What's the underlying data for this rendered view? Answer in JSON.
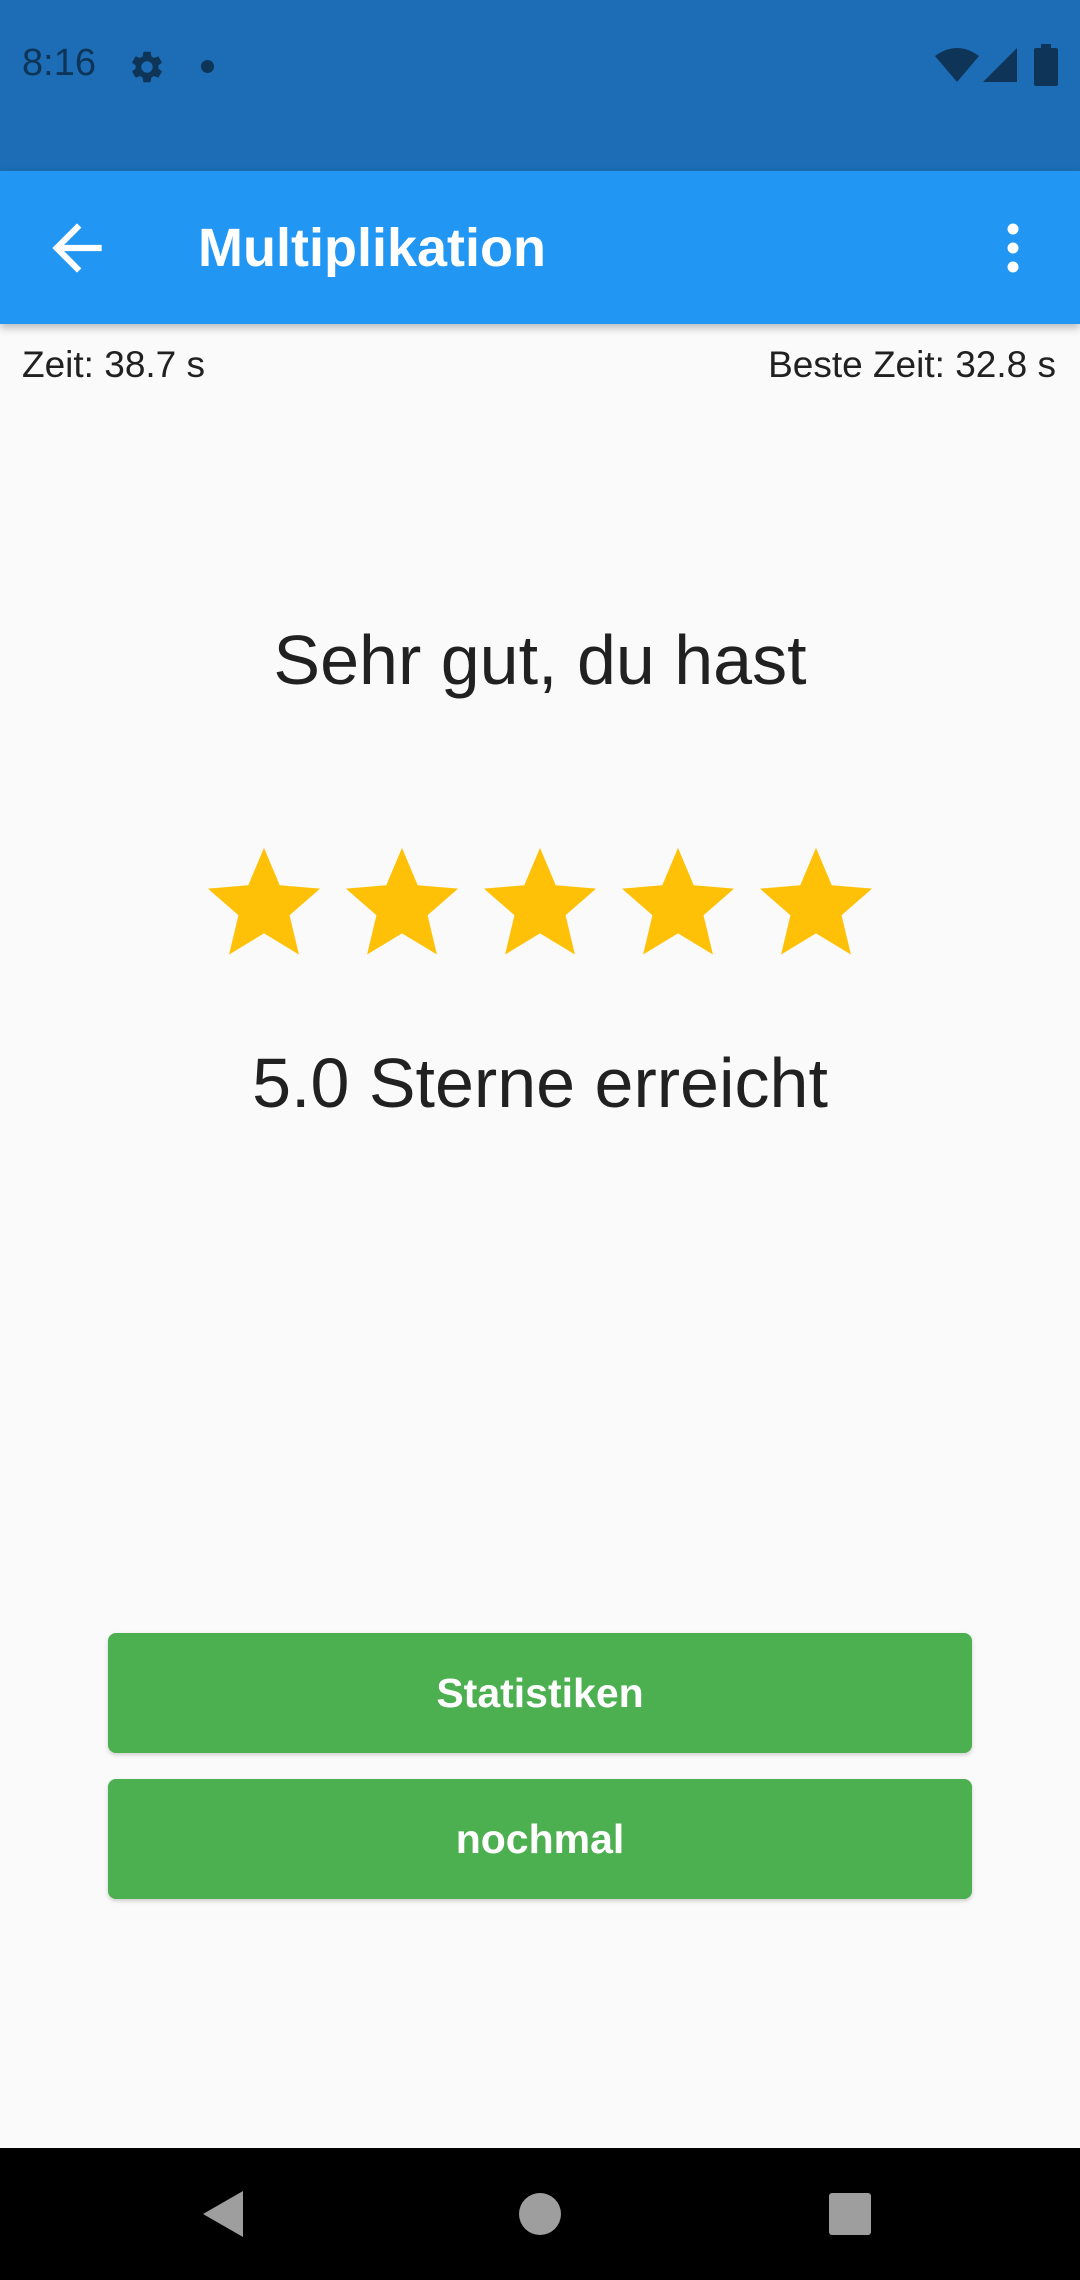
{
  "status_bar": {
    "time": "8:16",
    "icons": [
      "gear-icon",
      "notification-dot-icon",
      "wifi-icon",
      "signal-icon",
      "battery-icon"
    ]
  },
  "app_bar": {
    "title": "Multiplikation",
    "back_icon": "arrow-back-icon",
    "menu_icon": "more-vert-icon"
  },
  "timer": {
    "current": "Zeit: 38.7 s",
    "best": "Beste Zeit: 32.8 s"
  },
  "result": {
    "heading": "Sehr gut, du hast",
    "rating": 5,
    "rating_max": 5,
    "score_text": "5.0 Sterne erreicht"
  },
  "buttons": {
    "statistics": "Statistiken",
    "again": "nochmal"
  },
  "colors": {
    "status_bar": "#1c6db5",
    "app_bar": "#2196f3",
    "star": "#ffc107",
    "button": "#4caf50"
  },
  "nav_bar": {
    "icons": [
      "nav-back-icon",
      "nav-home-icon",
      "nav-recent-apps-icon"
    ]
  }
}
